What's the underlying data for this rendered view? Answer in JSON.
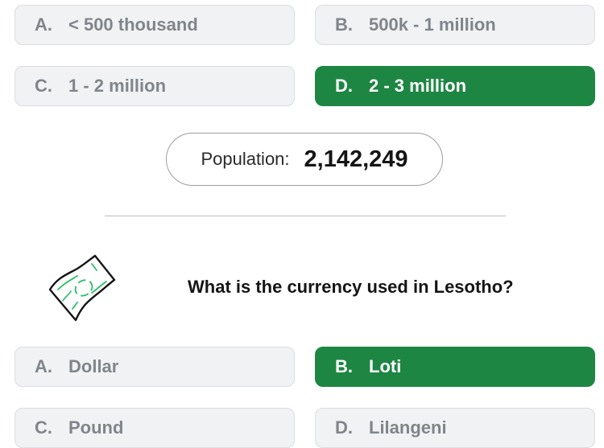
{
  "population_question": {
    "options": [
      {
        "letter": "A.",
        "text": "< 500 thousand",
        "state": "default"
      },
      {
        "letter": "B.",
        "text": "500k - 1 million",
        "state": "default"
      },
      {
        "letter": "C.",
        "text": "1 - 2 million",
        "state": "default"
      },
      {
        "letter": "D.",
        "text": "2 - 3 million",
        "state": "correct"
      }
    ],
    "result_label": "Population:",
    "result_value": "2,142,249"
  },
  "currency_question": {
    "icon": "banknote-icon",
    "question": "What is the currency used in Lesotho?",
    "options": [
      {
        "letter": "A.",
        "text": "Dollar",
        "state": "default"
      },
      {
        "letter": "B.",
        "text": "Loti",
        "state": "correct"
      },
      {
        "letter": "C.",
        "text": "Pound",
        "state": "default"
      },
      {
        "letter": "D.",
        "text": "Lilangeni",
        "state": "default"
      }
    ]
  },
  "colors": {
    "correct": "#1e8643",
    "option_bg": "#f1f2f4",
    "option_text": "#80858c",
    "icon_accent": "#2bbf6a"
  }
}
